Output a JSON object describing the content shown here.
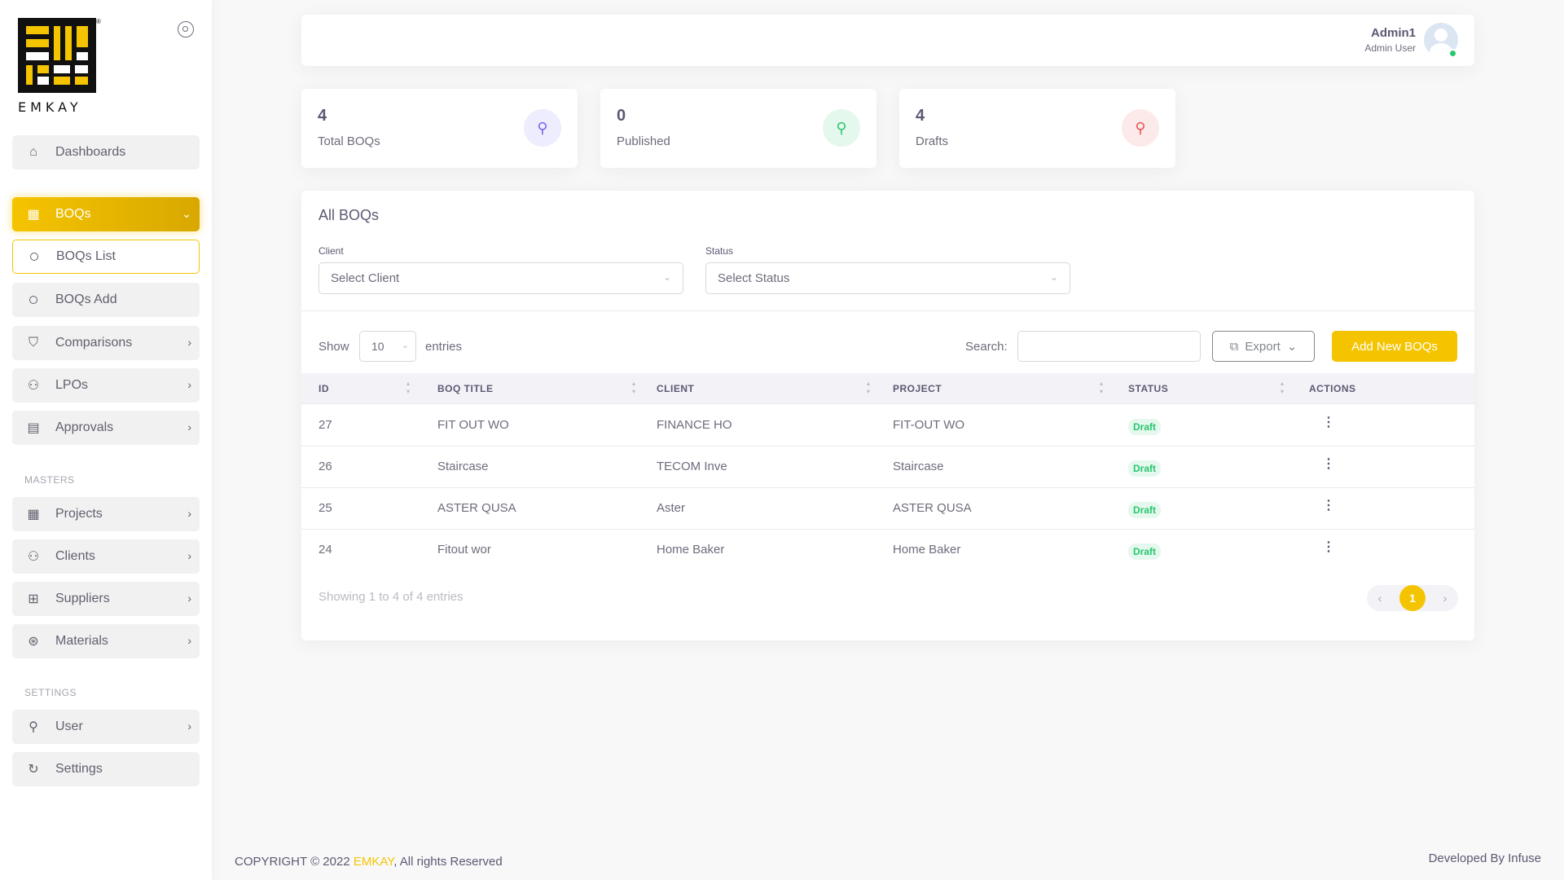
{
  "brand": {
    "name": "EMKAY",
    "registered": "®"
  },
  "sidebar": {
    "items": [
      {
        "label": "Dashboards",
        "icon": "home-icon"
      },
      {
        "label": "BOQs",
        "icon": "grid-icon"
      },
      {
        "label": "BOQs List",
        "icon": "circle-icon"
      },
      {
        "label": "BOQs Add",
        "icon": "circle-icon"
      },
      {
        "label": "Comparisons",
        "icon": "shield-icon"
      },
      {
        "label": "LPOs",
        "icon": "user-check-icon"
      },
      {
        "label": "Approvals",
        "icon": "file-icon"
      }
    ],
    "masters_label": "MASTERS",
    "masters": [
      {
        "label": "Projects",
        "icon": "grid-icon"
      },
      {
        "label": "Clients",
        "icon": "user-check-icon"
      },
      {
        "label": "Suppliers",
        "icon": "map-icon"
      },
      {
        "label": "Materials",
        "icon": "life-buoy-icon"
      }
    ],
    "settings_label": "SETTINGS",
    "settings": [
      {
        "label": "User",
        "icon": "user-icon"
      },
      {
        "label": "Settings",
        "icon": "refresh-icon"
      }
    ]
  },
  "header": {
    "user_name": "Admin1",
    "user_role": "Admin User"
  },
  "stats": [
    {
      "value": "4",
      "label": "Total BOQs",
      "color": "#7367f0",
      "bg": "#eeedfd"
    },
    {
      "value": "0",
      "label": "Published",
      "color": "#28c76f",
      "bg": "#e5f8ed"
    },
    {
      "value": "4",
      "label": "Drafts",
      "color": "#ea5455",
      "bg": "#fceaea"
    }
  ],
  "main": {
    "title": "All BOQs",
    "filters": {
      "client_label": "Client",
      "client_placeholder": "Select Client",
      "status_label": "Status",
      "status_placeholder": "Select Status"
    },
    "show_label": "Show",
    "entries_value": "10",
    "entries_label": "entries",
    "search_label": "Search:",
    "export_label": "Export",
    "add_label": "Add New BOQs",
    "columns": [
      "ID",
      "BOQ TITLE",
      "CLIENT",
      "PROJECT",
      "STATUS",
      "ACTIONS"
    ],
    "rows": [
      {
        "id": "27",
        "title": "FIT OUT WO",
        "client": "FINANCE HO",
        "project": "FIT-OUT WO",
        "status": "Draft"
      },
      {
        "id": "26",
        "title": "Staircase",
        "client": "TECOM Inve",
        "project": "Staircase",
        "status": "Draft"
      },
      {
        "id": "25",
        "title": "ASTER QUSA",
        "client": "Aster",
        "project": "ASTER QUSA",
        "status": "Draft"
      },
      {
        "id": "24",
        "title": "Fitout wor",
        "client": "Home Baker",
        "project": "Home Baker",
        "status": "Draft"
      }
    ],
    "info": "Showing 1 to 4 of 4 entries",
    "current_page": "1"
  },
  "footer": {
    "copyright_prefix": "COPYRIGHT © 2022 ",
    "brand": "EMKAY",
    "copyright_suffix": ", All rights Reserved",
    "developed": "Developed By Infuse"
  },
  "colors": {
    "accent": "#f5c400",
    "success": "#28c76f"
  }
}
